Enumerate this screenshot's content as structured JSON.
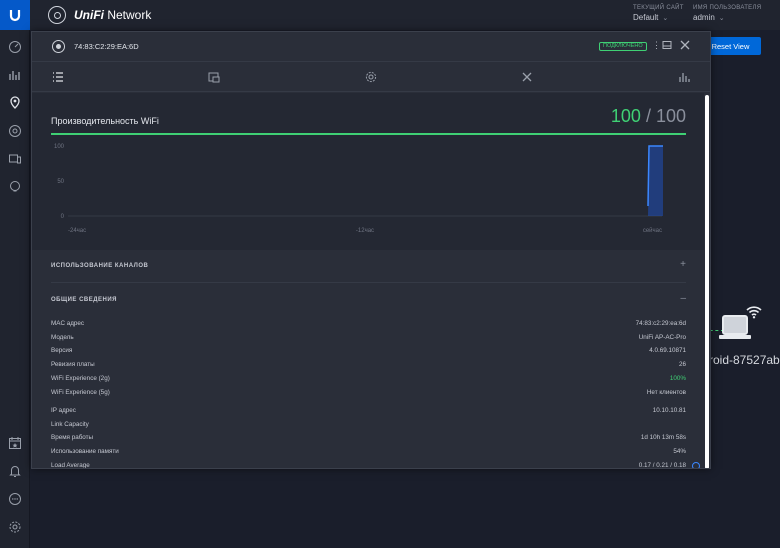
{
  "topbar": {
    "brand_prefix": "UniFi",
    "brand_suffix": "Network",
    "site_label": "ТЕКУЩИЙ САЙТ",
    "site_value": "Default",
    "user_label": "ИМЯ ПОЛЬЗОВАТЕЛЯ",
    "user_value": "admin"
  },
  "reset_view_label": "Reset View",
  "background_device_label": "roid-87527ab",
  "sidebar": {
    "icons": [
      "dashboard-icon",
      "statistics-icon",
      "map-icon",
      "devices-icon",
      "clients-icon",
      "insights-icon",
      "events-icon",
      "alerts-icon",
      "chat-icon",
      "settings-icon"
    ]
  },
  "modal": {
    "device_mac": "74:83:C2:29:EA:6D",
    "status": "ПОДКЛЮЧЕНО",
    "tabs": [
      "details-tab",
      "config-tab",
      "settings-tab",
      "tools-tab",
      "stats-tab"
    ],
    "performance": {
      "title": "Производительность WiFi",
      "score_current": "100",
      "score_separator": " / ",
      "score_max": "100"
    },
    "channel_usage_header": "ИСПОЛЬЗОВАНИЕ КАНАЛОВ",
    "general_header": "ОБЩИЕ СВЕДЕНИЯ",
    "info": [
      {
        "key": "MAC адрес",
        "value": "74:83:c2:29:ea:6d"
      },
      {
        "key": "Модель",
        "value": "UniFi AP-AC-Pro"
      },
      {
        "key": "Версия",
        "value": "4.0.69.10871"
      },
      {
        "key": "Ревизия платы",
        "value": "26"
      },
      {
        "key": "WiFi Experience (2g)",
        "value": "100%"
      },
      {
        "key": "WiFi Experience (5g)",
        "value": "Нет клиентов"
      },
      {
        "key": "IP адрес",
        "value": "10.10.10.81"
      },
      {
        "key": "Link Capacity",
        "value": ""
      },
      {
        "key": "Время работы",
        "value": "1d 10h 13m 58s"
      },
      {
        "key": "Использование памяти",
        "value": "54%"
      },
      {
        "key": "Load Average",
        "value": "0.17 / 0.21 / 0.18"
      }
    ]
  },
  "chart_data": {
    "type": "area",
    "x_tick_labels": [
      "-24час",
      "-12час",
      "сейчас"
    ],
    "y_tick_labels": [
      "100",
      "50",
      "0"
    ],
    "ylim": [
      0,
      100
    ],
    "series": [
      {
        "x": [
          -1.0,
          -0.3,
          -0.05,
          0
        ],
        "values": [
          0,
          100,
          100,
          100
        ]
      }
    ],
    "colors": {
      "fill": "#1f4fb8",
      "line": "#3b87ff"
    }
  },
  "colors": {
    "accent_green": "#3fd074",
    "accent_blue": "#0068d9"
  }
}
